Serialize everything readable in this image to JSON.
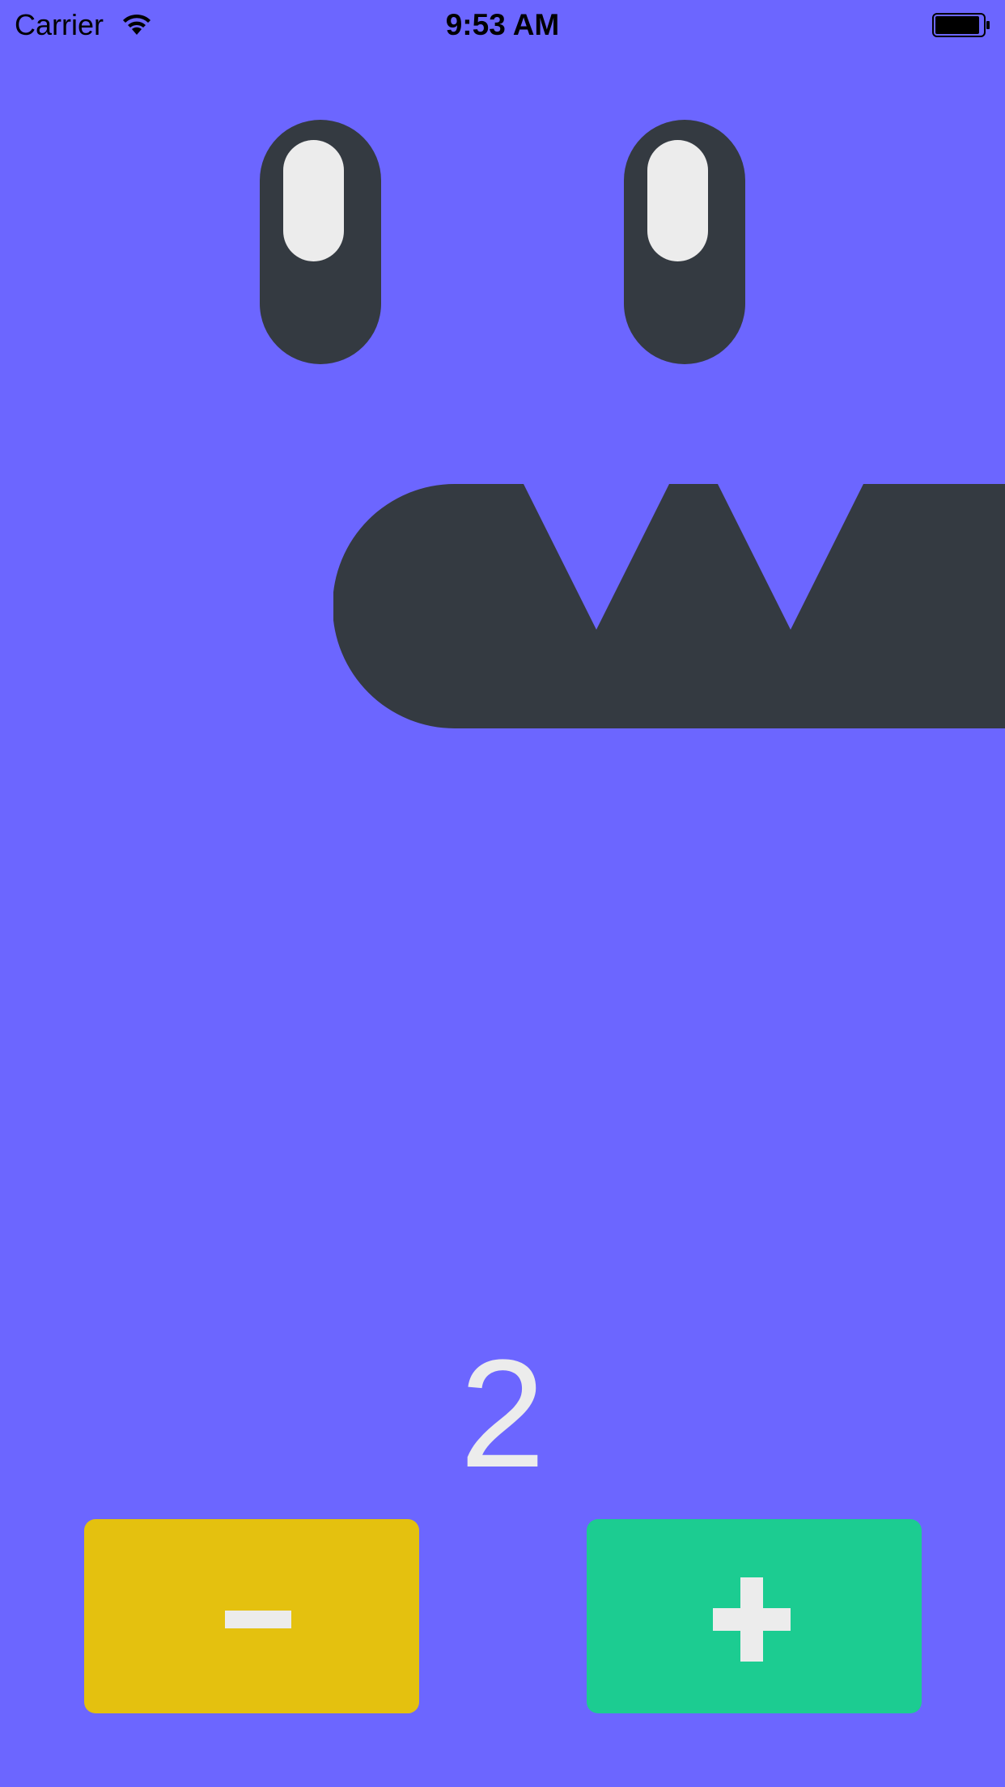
{
  "status_bar": {
    "carrier": "Carrier",
    "time": "9:53 AM",
    "wifi_icon": "wifi-icon",
    "battery_icon": "battery-icon"
  },
  "face": {
    "eye_color": "#343a41",
    "pupil_color": "#ececec",
    "mouth_color": "#343a41"
  },
  "counter": {
    "value": "2"
  },
  "controls": {
    "decrement_icon": "minus-icon",
    "decrement_color": "#e4c10f",
    "increment_icon": "plus-icon",
    "increment_color": "#1ccc91"
  },
  "theme": {
    "background": "#6c66ff",
    "glyph_color": "#ececec"
  }
}
